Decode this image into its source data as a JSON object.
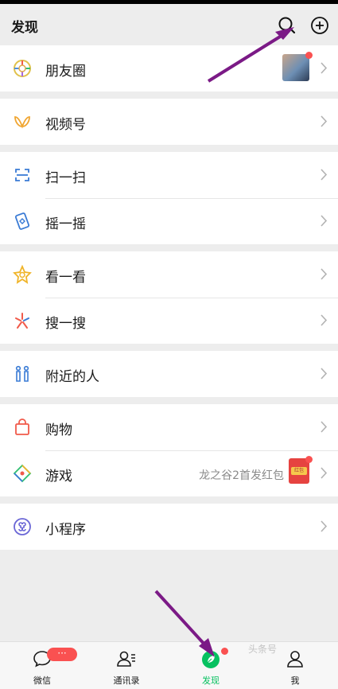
{
  "header": {
    "title": "发现",
    "search_icon": "search-icon",
    "add_icon": "plus-circle-icon"
  },
  "groups": [
    {
      "items": [
        {
          "label": "朋友圈",
          "icon": "moments-icon",
          "has_thumb": true
        }
      ]
    },
    {
      "items": [
        {
          "label": "视频号",
          "icon": "channels-icon"
        }
      ]
    },
    {
      "items": [
        {
          "label": "扫一扫",
          "icon": "scan-icon"
        },
        {
          "label": "摇一摇",
          "icon": "shake-icon"
        }
      ]
    },
    {
      "items": [
        {
          "label": "看一看",
          "icon": "top-stories-icon"
        },
        {
          "label": "搜一搜",
          "icon": "search-star-icon"
        }
      ]
    },
    {
      "items": [
        {
          "label": "附近的人",
          "icon": "nearby-people-icon"
        }
      ]
    },
    {
      "items": [
        {
          "label": "购物",
          "icon": "shopping-bag-icon"
        },
        {
          "label": "游戏",
          "icon": "games-icon",
          "subtitle": "龙之谷2首发红包",
          "red_packet_label": "红包"
        }
      ]
    },
    {
      "items": [
        {
          "label": "小程序",
          "icon": "mini-programs-icon"
        }
      ]
    }
  ],
  "tabbar": {
    "tabs": [
      {
        "label": "微信",
        "icon": "chat-icon",
        "badge": "···"
      },
      {
        "label": "通讯录",
        "icon": "contacts-icon"
      },
      {
        "label": "发现",
        "icon": "discover-icon",
        "active": true
      },
      {
        "label": "我",
        "icon": "me-icon"
      }
    ]
  },
  "colors": {
    "accent": "#07c160",
    "badge": "#fa5151",
    "arrow": "#7b1a86",
    "background": "#ededed"
  },
  "watermark": "头条号"
}
